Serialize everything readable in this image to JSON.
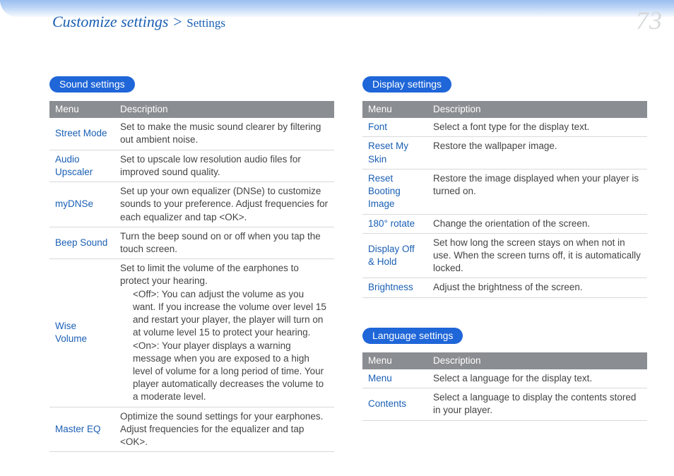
{
  "header": {
    "breadcrumb_main": "Customize settings > ",
    "breadcrumb_sub": "Settings",
    "page_number": "73"
  },
  "sections": {
    "sound": {
      "title": "Sound settings",
      "columns": {
        "menu": "Menu",
        "description": "Description"
      },
      "rows": [
        {
          "menu": "Street Mode",
          "desc": "Set to make the music sound clearer by filtering out ambient noise."
        },
        {
          "menu": "Audio Upscaler",
          "desc": "Set to upscale low resolution audio files for improved sound quality."
        },
        {
          "menu": "myDNSe",
          "desc": "Set up your own equalizer (DNSe) to customize sounds to your preference. Adjust frequencies for each equalizer and tap <OK>."
        },
        {
          "menu": "Beep Sound",
          "desc": "Turn the beep sound on or off when you tap the touch screen."
        },
        {
          "menu": "Wise Volume",
          "desc_intro": "Set to limit the volume of the earphones to protect your hearing.",
          "desc_off": "<Off>: You can adjust the volume as you want. If you increase the volume over level 15 and restart your player, the player will turn on at volume level 15 to protect your hearing.",
          "desc_on": "<On>: Your player displays a warning message when you are exposed to a high level of volume for a long period of time. Your player automatically decreases the volume to a moderate level."
        },
        {
          "menu": "Master EQ",
          "desc": "Optimize the sound settings for your earphones. Adjust frequencies for the equalizer and tap <OK>."
        }
      ]
    },
    "display": {
      "title": "Display settings",
      "columns": {
        "menu": "Menu",
        "description": "Description"
      },
      "rows": [
        {
          "menu": "Font",
          "desc": "Select a font type for the display text."
        },
        {
          "menu": "Reset My Skin",
          "desc": "Restore the wallpaper image."
        },
        {
          "menu": "Reset Booting Image",
          "desc": "Restore the image displayed when your player is turned on."
        },
        {
          "menu": "180° rotate",
          "desc": "Change the orientation of the screen."
        },
        {
          "menu": "Display Off & Hold",
          "desc": "Set how long the screen stays on when not in use. When the screen turns off, it is automatically locked."
        },
        {
          "menu": "Brightness",
          "desc": "Adjust the brightness of the screen."
        }
      ]
    },
    "language": {
      "title": "Language settings",
      "columns": {
        "menu": "Menu",
        "description": "Description"
      },
      "rows": [
        {
          "menu": "Menu",
          "desc": "Select a language for the display text."
        },
        {
          "menu": "Contents",
          "desc": "Select a language to display the contents stored in your player."
        }
      ]
    }
  }
}
